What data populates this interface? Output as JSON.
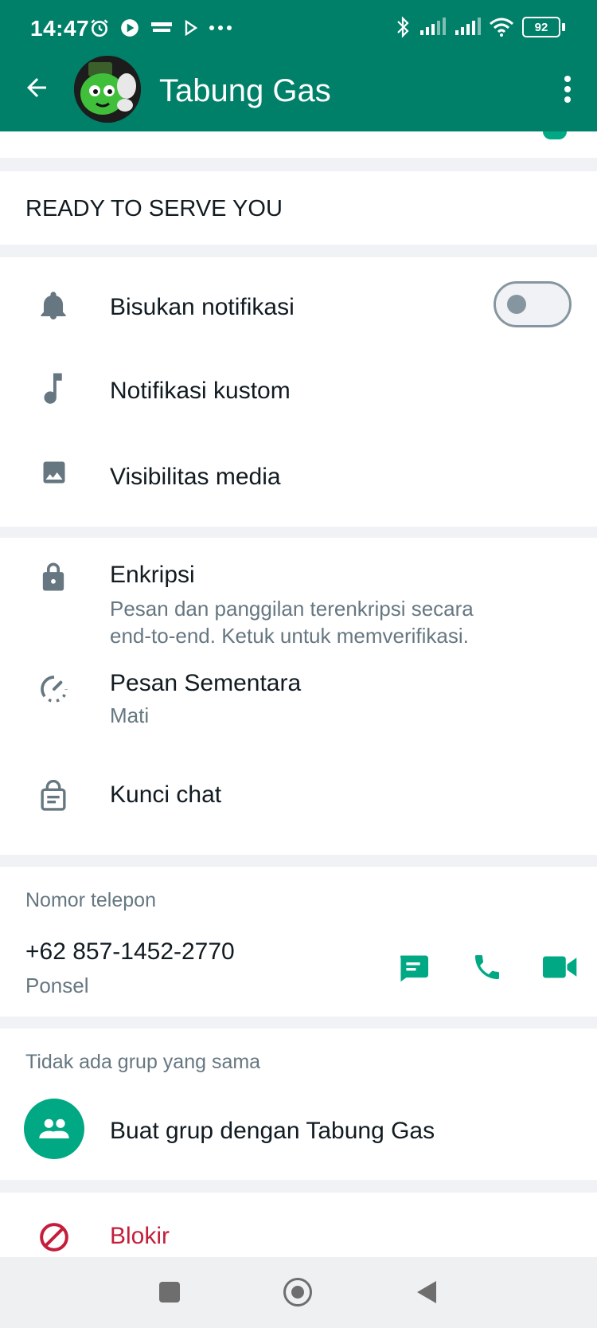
{
  "status_bar": {
    "time": "14:47",
    "battery": "92",
    "icons_left": [
      "alarm-icon",
      "royal-match-icon",
      "play-icon",
      "more-dots-icon"
    ],
    "icons_right": [
      "bluetooth-icon",
      "signal-icon",
      "signal-icon",
      "wifi-icon",
      "battery-icon"
    ]
  },
  "header": {
    "title": "Tabung Gas",
    "back_icon": "arrow-left-icon",
    "menu_icon": "kebab-menu-icon"
  },
  "about": {
    "text": "READY TO SERVE YOU"
  },
  "settings": {
    "mute_label": "Bisukan notifikasi",
    "mute_enabled": false,
    "custom_label": "Notifikasi kustom",
    "media_label": "Visibilitas media"
  },
  "privacy": {
    "encryption_label": "Enkripsi",
    "encryption_desc_line1": "Pesan dan panggilan terenkripsi secara",
    "encryption_desc_line2": "end-to-end. Ketuk untuk memverifikasi.",
    "disappearing_label": "Pesan Sementara",
    "disappearing_value": "Mati",
    "lock_label": "Kunci chat"
  },
  "phone": {
    "section_title": "Nomor telepon",
    "number": "+62 857-1452-2770",
    "type": "Ponsel"
  },
  "groups": {
    "section_title": "Tidak ada grup yang sama",
    "create_label": "Buat grup dengan Tabung Gas"
  },
  "block": {
    "label": "Blokir"
  },
  "colors": {
    "primary": "#008069",
    "accent": "#00a884",
    "danger": "#c41e3a",
    "secondary_text": "#667781"
  }
}
